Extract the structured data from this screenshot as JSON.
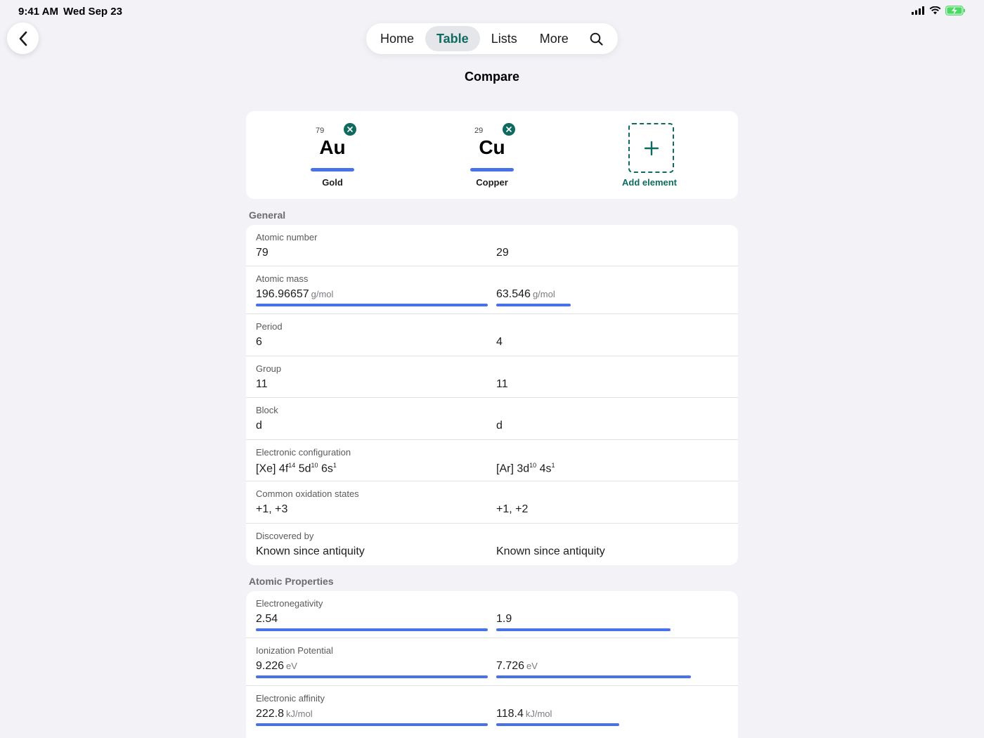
{
  "status": {
    "time": "9:41 AM",
    "date": "Wed Sep 23"
  },
  "nav": {
    "items": [
      "Home",
      "Table",
      "Lists",
      "More"
    ],
    "active": "Table"
  },
  "page": {
    "title": "Compare"
  },
  "elements": [
    {
      "number": "79",
      "symbol": "Au",
      "name": "Gold"
    },
    {
      "number": "29",
      "symbol": "Cu",
      "name": "Copper"
    }
  ],
  "add_element_label": "Add element",
  "general": {
    "title": "General",
    "rows": [
      {
        "label": "Atomic number",
        "a": "79",
        "b": "29"
      },
      {
        "label": "Atomic mass",
        "a": "196.96657",
        "b": "63.546",
        "unit": "g/mol",
        "bar_a": 1.0,
        "bar_b": 0.32
      },
      {
        "label": "Period",
        "a": "6",
        "b": "4"
      },
      {
        "label": "Group",
        "a": "11",
        "b": "11"
      },
      {
        "label": "Block",
        "a": "d",
        "b": "d"
      },
      {
        "label": "Electronic configuration",
        "a": "[Xe] 4f14 5d10 6s1",
        "b": "[Ar] 3d10 4s1"
      },
      {
        "label": "Common oxidation states",
        "a": "+1, +3",
        "b": "+1, +2"
      },
      {
        "label": "Discovered by",
        "a": "Known since antiquity",
        "b": "Known since antiquity"
      }
    ]
  },
  "atomic": {
    "title": "Atomic Properties",
    "rows": [
      {
        "label": "Electronegativity",
        "a": "2.54",
        "b": "1.9",
        "unit": "",
        "bar_a": 1.0,
        "bar_b": 0.75
      },
      {
        "label": "Ionization Potential",
        "a": "9.226",
        "b": "7.726",
        "unit": "eV",
        "bar_a": 1.0,
        "bar_b": 0.84
      },
      {
        "label": "Electronic affinity",
        "a": "222.8",
        "b": "118.4",
        "unit": "kJ/mol",
        "bar_a": 1.0,
        "bar_b": 0.53
      }
    ]
  },
  "colors": {
    "accent": "#0f6b5f",
    "bar": "#4a72e8"
  }
}
